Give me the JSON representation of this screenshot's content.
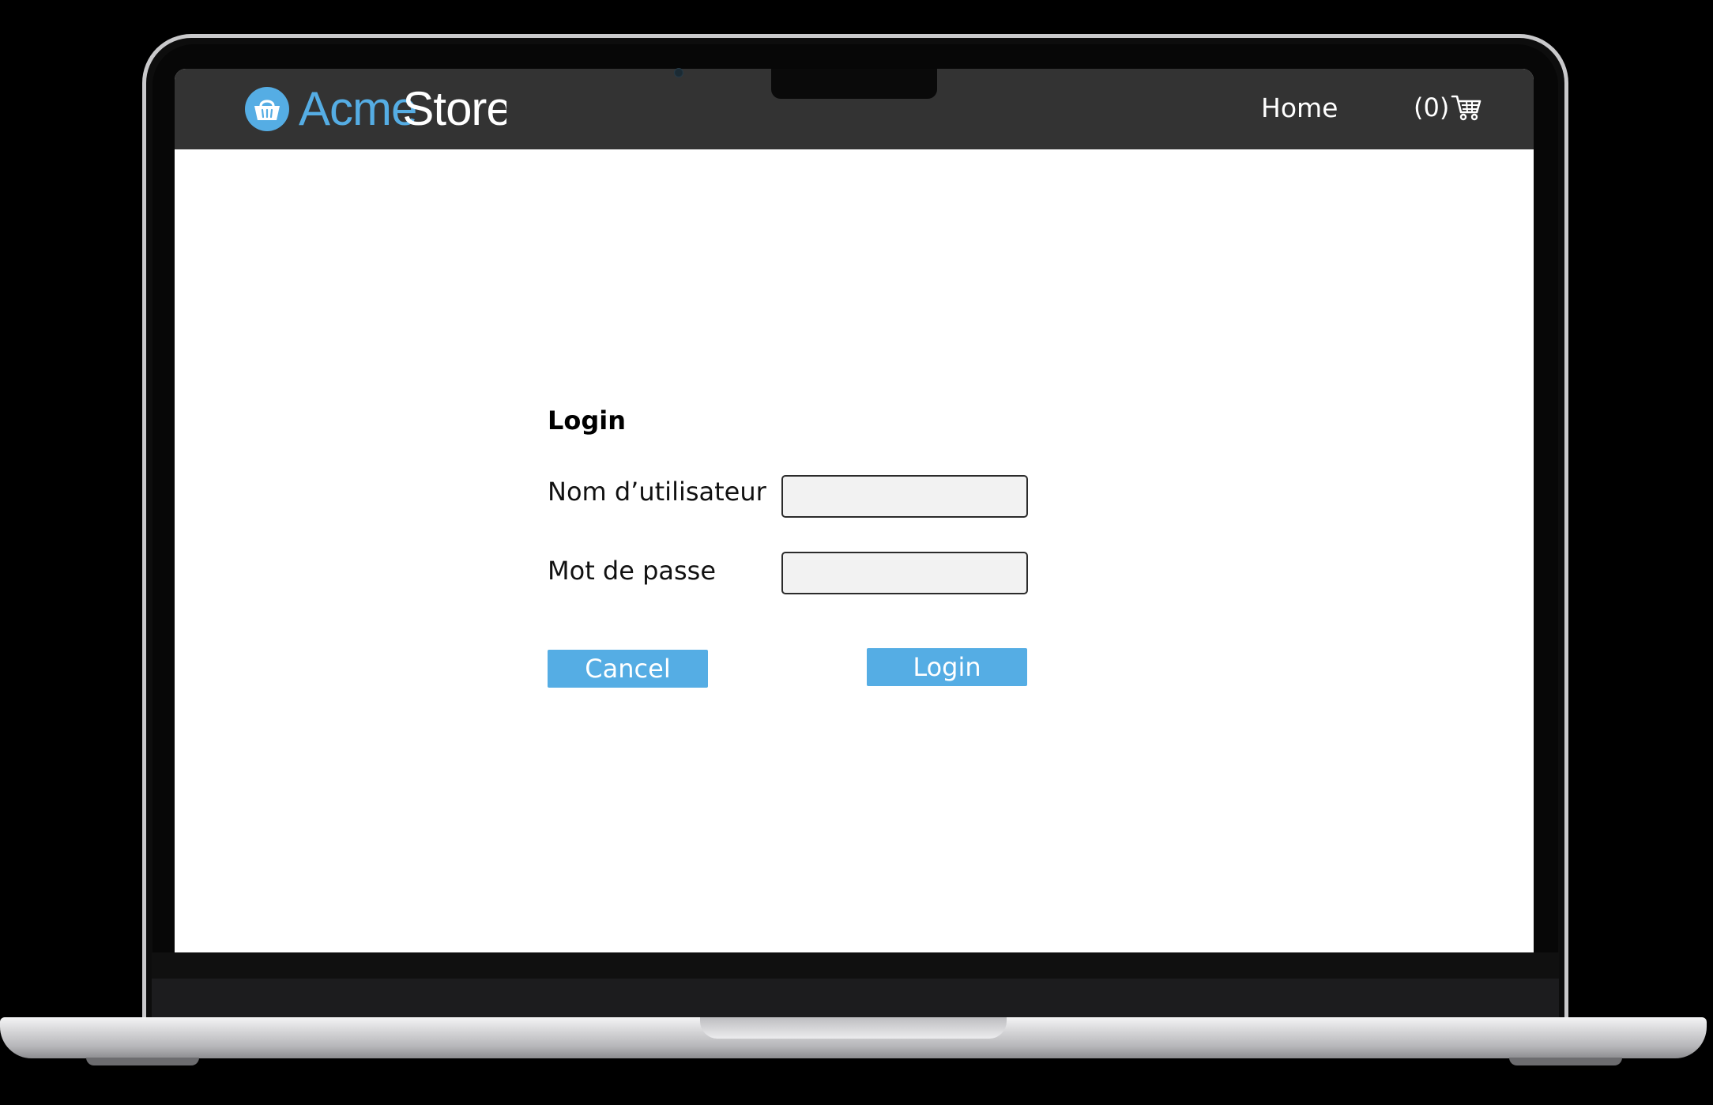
{
  "header": {
    "logo_acme": "Acme",
    "logo_store": "Store",
    "nav_home": "Home",
    "cart_count": "(0)"
  },
  "login_form": {
    "title": "Login",
    "username_label": "Nom d’utilisateur",
    "username_value": "",
    "password_label": "Mot de passe",
    "password_value": "",
    "cancel_label": "Cancel",
    "login_label": "Login"
  },
  "colors": {
    "accent": "#55ade4",
    "navbar_bg": "#333333",
    "input_bg": "#f2f2f2"
  },
  "icons": {
    "logo": "shopping-basket-icon",
    "cart": "shopping-cart-icon"
  }
}
